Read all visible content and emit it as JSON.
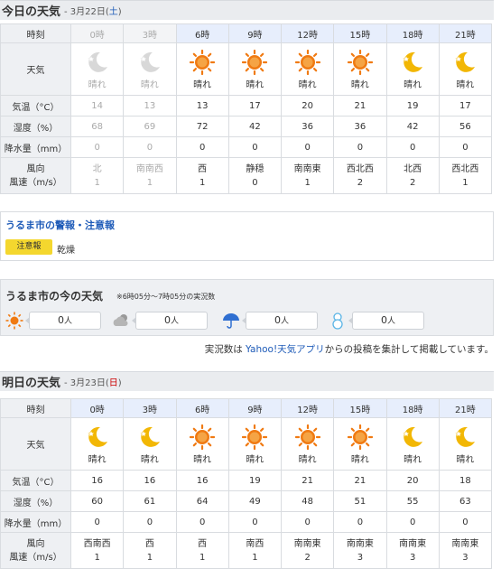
{
  "today": {
    "title": "今日の天気",
    "date_prefix": "- 3月22日(",
    "date_day": "土",
    "date_suffix": ")",
    "labels": {
      "hour": "時刻",
      "weather": "天気",
      "temp": "気温（°C）",
      "humidity": "湿度（%）",
      "precip": "降水量（mm）",
      "wind_dir": "風向",
      "wind_speed": "風速（m/s）"
    },
    "columns": [
      {
        "hour": "0時",
        "icon": "moon-icon",
        "weather": "晴れ",
        "temp": "14",
        "humidity": "68",
        "precip": "0",
        "wind_dir": "北",
        "wind_speed": "1",
        "past": true
      },
      {
        "hour": "3時",
        "icon": "moon-icon",
        "weather": "晴れ",
        "temp": "13",
        "humidity": "69",
        "precip": "0",
        "wind_dir": "南南西",
        "wind_speed": "1",
        "past": true
      },
      {
        "hour": "6時",
        "icon": "sun-icon",
        "weather": "晴れ",
        "temp": "13",
        "humidity": "72",
        "precip": "0",
        "wind_dir": "西",
        "wind_speed": "1",
        "past": false
      },
      {
        "hour": "9時",
        "icon": "sun-icon",
        "weather": "晴れ",
        "temp": "17",
        "humidity": "42",
        "precip": "0",
        "wind_dir": "静穏",
        "wind_speed": "0",
        "past": false
      },
      {
        "hour": "12時",
        "icon": "sun-icon",
        "weather": "晴れ",
        "temp": "20",
        "humidity": "36",
        "precip": "0",
        "wind_dir": "南南東",
        "wind_speed": "1",
        "past": false
      },
      {
        "hour": "15時",
        "icon": "sun-icon",
        "weather": "晴れ",
        "temp": "21",
        "humidity": "36",
        "precip": "0",
        "wind_dir": "西北西",
        "wind_speed": "2",
        "past": false
      },
      {
        "hour": "18時",
        "icon": "moon-icon",
        "weather": "晴れ",
        "temp": "19",
        "humidity": "42",
        "precip": "0",
        "wind_dir": "北西",
        "wind_speed": "2",
        "past": false
      },
      {
        "hour": "21時",
        "icon": "moon-icon",
        "weather": "晴れ",
        "temp": "17",
        "humidity": "56",
        "precip": "0",
        "wind_dir": "西北西",
        "wind_speed": "1",
        "past": false
      }
    ]
  },
  "warning": {
    "title": "うるま市の警報・注意報",
    "badge": "注意報",
    "text": "乾燥"
  },
  "now": {
    "title": "うるま市の今の天気",
    "subtitle": "※6時05分〜7時05分の実況数",
    "items": [
      {
        "icon": "sun-icon",
        "count": "0",
        "unit": "人"
      },
      {
        "icon": "cloud-icon",
        "count": "0",
        "unit": "人"
      },
      {
        "icon": "umbrella-icon",
        "count": "0",
        "unit": "人"
      },
      {
        "icon": "snowman-icon",
        "count": "0",
        "unit": "人"
      }
    ]
  },
  "report": {
    "prefix": "実況数は ",
    "link": "Yahoo!天気アプリ",
    "suffix": "からの投稿を集計して掲載しています。"
  },
  "tomorrow": {
    "title": "明日の天気",
    "date_prefix": "- 3月23日(",
    "date_day": "日",
    "date_suffix": ")",
    "labels": {
      "hour": "時刻",
      "weather": "天気",
      "temp": "気温（°C）",
      "humidity": "湿度（%）",
      "precip": "降水量（mm）",
      "wind_dir": "風向",
      "wind_speed": "風速（m/s）"
    },
    "columns": [
      {
        "hour": "0時",
        "icon": "moon-icon",
        "weather": "晴れ",
        "temp": "16",
        "humidity": "60",
        "precip": "0",
        "wind_dir": "西南西",
        "wind_speed": "1",
        "past": false
      },
      {
        "hour": "3時",
        "icon": "moon-icon",
        "weather": "晴れ",
        "temp": "16",
        "humidity": "61",
        "precip": "0",
        "wind_dir": "西",
        "wind_speed": "1",
        "past": false
      },
      {
        "hour": "6時",
        "icon": "sun-icon",
        "weather": "晴れ",
        "temp": "16",
        "humidity": "64",
        "precip": "0",
        "wind_dir": "西",
        "wind_speed": "1",
        "past": false
      },
      {
        "hour": "9時",
        "icon": "sun-icon",
        "weather": "晴れ",
        "temp": "19",
        "humidity": "49",
        "precip": "0",
        "wind_dir": "南西",
        "wind_speed": "1",
        "past": false
      },
      {
        "hour": "12時",
        "icon": "sun-icon",
        "weather": "晴れ",
        "temp": "21",
        "humidity": "48",
        "precip": "0",
        "wind_dir": "南南東",
        "wind_speed": "2",
        "past": false
      },
      {
        "hour": "15時",
        "icon": "sun-icon",
        "weather": "晴れ",
        "temp": "21",
        "humidity": "51",
        "precip": "0",
        "wind_dir": "南南東",
        "wind_speed": "3",
        "past": false
      },
      {
        "hour": "18時",
        "icon": "moon-icon",
        "weather": "晴れ",
        "temp": "20",
        "humidity": "55",
        "precip": "0",
        "wind_dir": "南南東",
        "wind_speed": "3",
        "past": false
      },
      {
        "hour": "21時",
        "icon": "moon-icon",
        "weather": "晴れ",
        "temp": "18",
        "humidity": "63",
        "precip": "0",
        "wind_dir": "南南東",
        "wind_speed": "3",
        "past": false
      }
    ]
  },
  "colors": {
    "link": "#1e5bb8",
    "sun": "#f07a12",
    "moon": "#f2b705",
    "warning_badge": "#f4d72e",
    "saturday": "#1e5bb8",
    "sunday": "#cc0000"
  }
}
